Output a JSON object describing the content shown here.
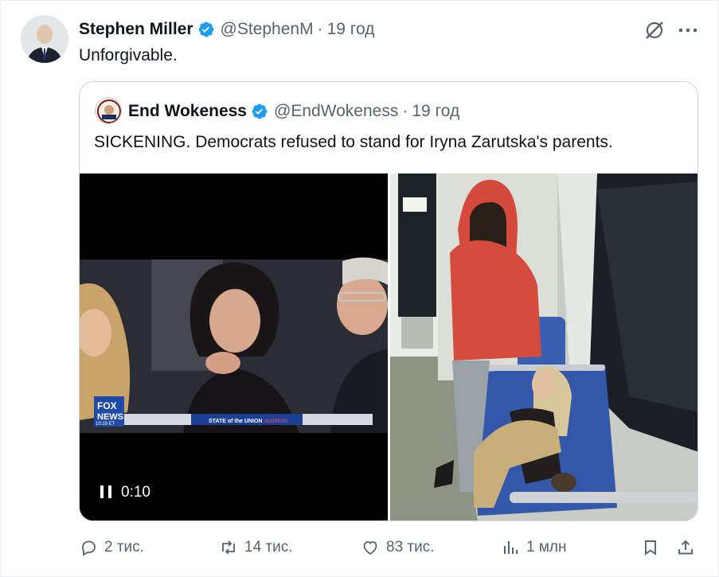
{
  "author": {
    "name": "Stephen Miller",
    "handle": "@StephenM",
    "separator": "·",
    "time": "19 год"
  },
  "tweet_text": "Unforgivable.",
  "quoted": {
    "name": "End Wokeness",
    "handle": "@EndWokeness",
    "separator": "·",
    "time": "19 год",
    "text": "SICKENING. Democrats refused to stand for Iryna Zarutska's parents.",
    "video_time": "0:10",
    "video_overlay": {
      "logo_top": "FOX",
      "logo_bottom": "NEWS",
      "clock": "10:19 ET",
      "banner": "STATE of the UNION",
      "banner_suffix": "ADDRESS"
    }
  },
  "actions": {
    "replies": "2 тис.",
    "reposts": "14 тис.",
    "likes": "83 тис.",
    "views": "1 млн"
  },
  "colors": {
    "verified": "#1d9bf0",
    "muted": "#536471",
    "border": "#cfd9de"
  }
}
